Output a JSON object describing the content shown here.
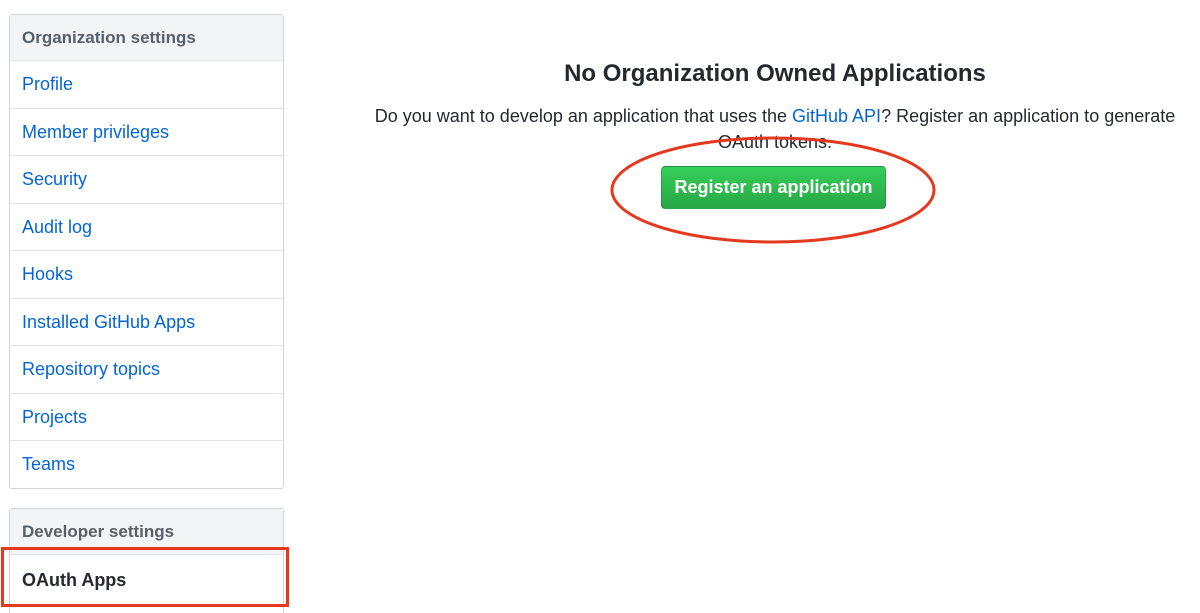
{
  "org_settings": {
    "heading": "Organization settings",
    "items": [
      {
        "label": "Profile"
      },
      {
        "label": "Member privileges"
      },
      {
        "label": "Security"
      },
      {
        "label": "Audit log"
      },
      {
        "label": "Hooks"
      },
      {
        "label": "Installed GitHub Apps"
      },
      {
        "label": "Repository topics"
      },
      {
        "label": "Projects"
      },
      {
        "label": "Teams"
      }
    ]
  },
  "dev_settings": {
    "heading": "Developer settings",
    "selected_item": "OAuth Apps"
  },
  "main": {
    "title": "No Organization Owned Applications",
    "desc_before": "Do you want to develop an application that uses the ",
    "desc_link": "GitHub API",
    "desc_after": "? Register an application to generate OAuth tokens.",
    "button_label": "Register an application"
  },
  "colors": {
    "link": "#0366d6",
    "button_green": "#28a745",
    "annotation_red": "#e5391f"
  }
}
